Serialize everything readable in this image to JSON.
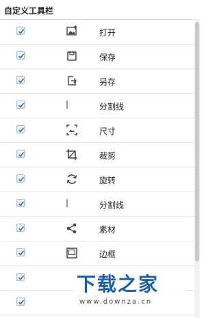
{
  "panel": {
    "title": "自定义工具栏"
  },
  "rows": [
    {
      "checked": true,
      "icon": "image-upload-icon",
      "label": "打开"
    },
    {
      "checked": true,
      "icon": "save-icon",
      "label": "保存"
    },
    {
      "checked": true,
      "icon": "save-as-icon",
      "label": "另存"
    },
    {
      "checked": true,
      "icon": "separator-icon",
      "label": "分割线"
    },
    {
      "checked": true,
      "icon": "resize-icon",
      "label": "尺寸"
    },
    {
      "checked": true,
      "icon": "crop-icon",
      "label": "裁剪"
    },
    {
      "checked": true,
      "icon": "rotate-icon",
      "label": "旋转"
    },
    {
      "checked": true,
      "icon": "separator-icon",
      "label": "分割线"
    },
    {
      "checked": true,
      "icon": "share-icon",
      "label": "素材"
    },
    {
      "checked": true,
      "icon": "frame-icon",
      "label": "边框"
    },
    {
      "checked": true,
      "icon": "",
      "label": ""
    },
    {
      "checked": true,
      "icon": "",
      "label": ""
    }
  ],
  "watermark": {
    "text": "下载之家",
    "url": "www.downza.cn"
  },
  "colors": {
    "checkbox_border": "#9fb7d4",
    "checkmark": "#2f6db5",
    "watermark_blue": "#1d5fa8"
  }
}
